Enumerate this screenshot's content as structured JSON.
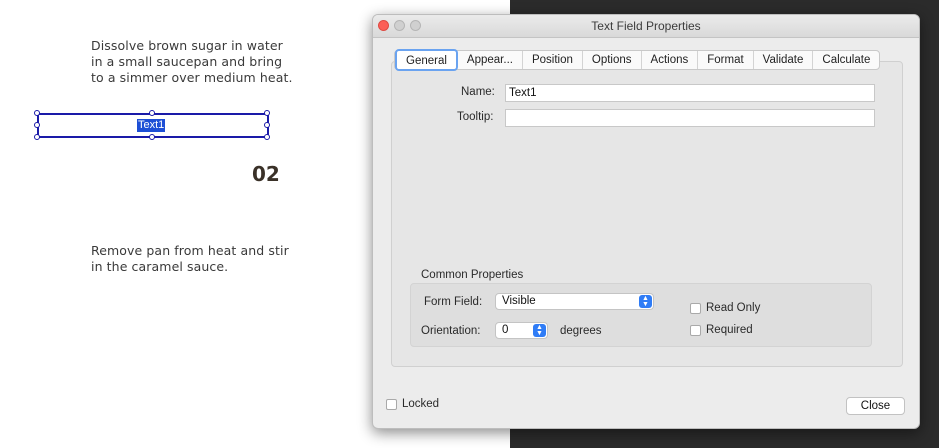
{
  "document": {
    "step1_lines": [
      "Dissolve brown sugar in water",
      "in a small saucepan and bring",
      "to a simmer over medium heat."
    ],
    "field_label": "Text1",
    "step_number": "02",
    "step2_lines": [
      "Remove pan from heat and stir",
      "in the caramel sauce."
    ]
  },
  "dialog": {
    "title": "Text Field Properties",
    "tabs": [
      "General",
      "Appear...",
      "Position",
      "Options",
      "Actions",
      "Format",
      "Validate",
      "Calculate"
    ],
    "active_tab": "General",
    "name_label": "Name:",
    "name_value": "Text1",
    "tooltip_label": "Tooltip:",
    "tooltip_value": "",
    "common_properties": {
      "heading": "Common Properties",
      "form_field_label": "Form Field:",
      "form_field_value": "Visible",
      "orientation_label": "Orientation:",
      "orientation_value": "0",
      "degrees_label": "degrees",
      "read_only_label": "Read Only",
      "read_only_checked": false,
      "required_label": "Required",
      "required_checked": false
    },
    "locked_label": "Locked",
    "locked_checked": false,
    "close_label": "Close"
  },
  "colors": {
    "accent": "#2f7cf6",
    "field_border": "#1a1aa8",
    "selection": "#1d4fd6",
    "close_light": "#fc5f57"
  }
}
